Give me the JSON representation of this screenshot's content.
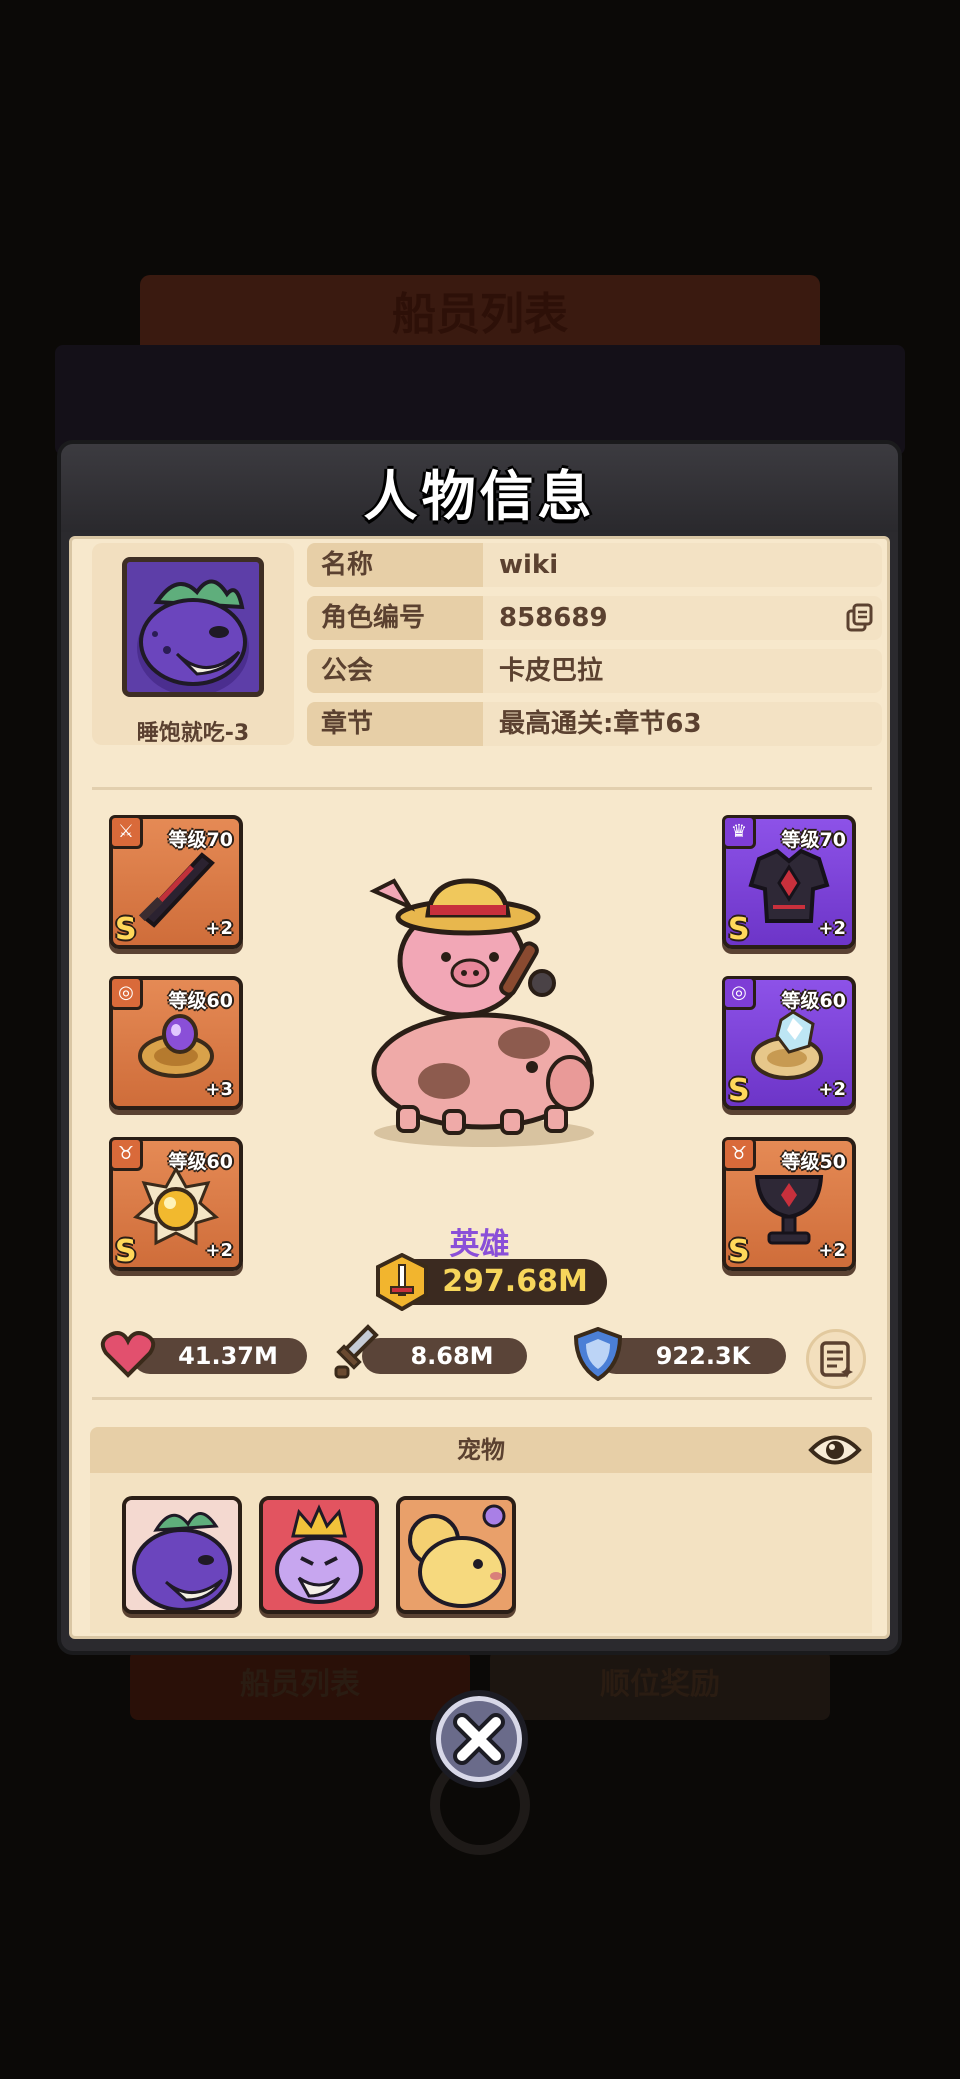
{
  "background": {
    "banner_label": "船员列表",
    "tabs": [
      "船员列表",
      "顺位奖励"
    ]
  },
  "panel": {
    "title": "人物信息"
  },
  "player": {
    "avatar_name": "睡饱就吃-3",
    "rows": [
      {
        "label": "名称",
        "value": "wiki"
      },
      {
        "label": "角色编号",
        "value": "858689"
      },
      {
        "label": "公会",
        "value": "卡皮巴拉"
      },
      {
        "label": "章节",
        "value": "最高通关:章节63"
      }
    ]
  },
  "equipment": {
    "left": [
      {
        "slot": "sword-icon",
        "level": "等级70",
        "grade": "S",
        "plus": "+2",
        "color": "orange",
        "item": "dark-sword"
      },
      {
        "slot": "ring-icon",
        "level": "等级60",
        "grade": "",
        "plus": "+3",
        "color": "orange",
        "item": "gold-ring"
      },
      {
        "slot": "necklace-icon",
        "level": "等级60",
        "grade": "S",
        "plus": "+2",
        "color": "orange",
        "item": "sun-amulet"
      }
    ],
    "right": [
      {
        "slot": "armor-icon",
        "level": "等级70",
        "grade": "S",
        "plus": "+2",
        "color": "purple",
        "item": "dark-armor"
      },
      {
        "slot": "ring-icon",
        "level": "等级60",
        "grade": "S",
        "plus": "+2",
        "color": "purple",
        "item": "crystal-ring"
      },
      {
        "slot": "necklace-icon",
        "level": "等级50",
        "grade": "S",
        "plus": "+2",
        "color": "orange",
        "item": "dark-chalice"
      }
    ]
  },
  "hero": {
    "rank": "英雄",
    "power": "297.68M"
  },
  "stats": {
    "hp": "41.37M",
    "attack": "8.68M",
    "defense": "922.3K"
  },
  "pets": {
    "title": "宠物",
    "items": [
      "purple-dino-pet",
      "king-slime-pet",
      "yellow-mouse-pet"
    ]
  },
  "colors": {
    "panel_bg": "#f7e8cc",
    "orange_slot": "#e58a55",
    "purple_slot": "#8d52e8",
    "power_text": "#f7d65b",
    "rank_text": "#8a4fd8"
  }
}
